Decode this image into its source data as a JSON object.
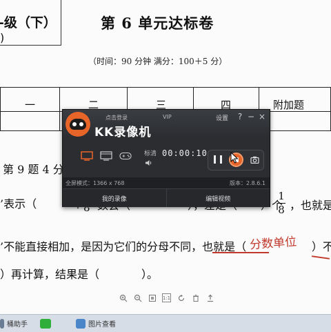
{
  "document": {
    "grade_title": "-级（下）",
    "grade_paren": ")",
    "exam_title": "第 6 单元达标卷",
    "time_score": "（时间：90 分钟   满分：100＋5 分）",
    "table_headers": [
      "一",
      "二",
      "三",
      "四",
      "附加题"
    ],
    "lines": [
      "第 9 题 4 分",
      "’表示（",
      "个",
      "8",
      "数会（",
      "），差是（",
      "）个",
      "1",
      "，也就是",
      "’不能直接相加，是因为它们的分母不同，也就是（",
      "）不同",
      "）再计算，结果是（",
      "）。"
    ],
    "handwriting": "分数单位"
  },
  "pdf_toolbar": {
    "icons": [
      "zoom-in-icon",
      "zoom-out-icon",
      "fit-page-icon",
      "actual-size-icon",
      "rotate-icon",
      "delete-icon",
      "share-icon"
    ],
    "actual_size_label": "1:1"
  },
  "taskbar": {
    "items": [
      {
        "label": "桶助手",
        "icon": "assistant-icon"
      },
      {
        "label": "",
        "icon": "wechat-icon"
      },
      {
        "label": "图片查看",
        "icon": "image-viewer-icon"
      }
    ]
  },
  "kk_recorder": {
    "login_label": "点击登录",
    "vip_label": "VIP",
    "app_title": "KK录像机",
    "settings_label": "设置",
    "help_label": "?",
    "minimize_label": "−",
    "close_label": "×",
    "quality_label": "标清",
    "timer": "00:00:10",
    "fullscreen_mode": "全屏模式：1366 x 768",
    "version": "版本：2.8.6.1",
    "tabs": [
      "我的录像",
      "编辑视频"
    ],
    "accent_color": "#e8652a",
    "active_mode_color": "#e8652a"
  }
}
